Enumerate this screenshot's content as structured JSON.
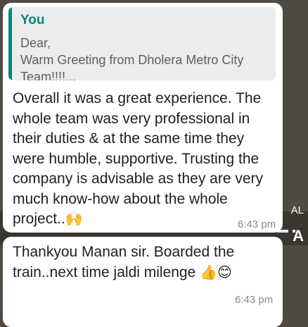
{
  "background_edge": {
    "right_text_top": "AL",
    "right_text_bottom": "A"
  },
  "messages": [
    {
      "quote": {
        "sender": "You",
        "lines": [
          "Dear,",
          "Warm Greeting from Dholera Metro City",
          "Team!!!!..."
        ]
      },
      "text": "Overall it was a great experience. The whole team was very professional in their duties & at the same time they were humble, supportive. Trusting the company is advisable as they are very much know-how about the whole project..",
      "emoji": "🙌",
      "time": "6:43 pm"
    },
    {
      "text": "Thankyou Manan sir. Boarded the train..next time jaldi milenge ",
      "emoji": "👍😊",
      "time": "6:43 pm"
    }
  ],
  "colors": {
    "accent": "#07867a",
    "bubble": "#ffffff",
    "quote_bg": "#ececec",
    "text": "#1f1f1f",
    "timestamp": "#8a8a8a"
  }
}
